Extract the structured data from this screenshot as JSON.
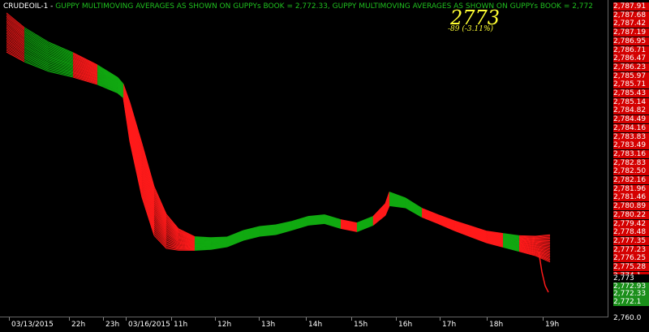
{
  "header": {
    "symbol": "CRUDEOIL-1",
    "separator": " - ",
    "indicator_1": "GUPPY MULTIMOVING AVERAGES AS SHOWN ON GUPPYs BOOK = 2,772.33,",
    "indicator_2": "GUPPY MULTIMOVING AVERAGES AS SHOWN ON GUPPYs BOOK = 2,772",
    "big_price": "2773",
    "change": "-89  (-3.11%)"
  },
  "price_axis": {
    "labels": [
      "2,787.91",
      "2,787.68",
      "2,787.42",
      "2,787.19",
      "2,786.95",
      "2,786.71",
      "2,786.47",
      "2,786.23",
      "2,785.97",
      "2,785.71",
      "2,785.43",
      "2,785.14",
      "2,784.82",
      "2,784.49",
      "2,784.16",
      "2,783.83",
      "2,783.49",
      "2,783.16",
      "2,782.83",
      "2,782.50",
      "2,782.16",
      "2,781.96",
      "2,781.46",
      "2,780.89",
      "2,780.22",
      "2,779.42",
      "2,778.48",
      "2,777.35",
      "2,777.23",
      "2,776.25",
      "2,775.28",
      "2,774.1"
    ],
    "current_labels": [
      "2,773",
      "2,772.93",
      "2,772.33",
      "2,772.1"
    ],
    "bottom_label": "2,760.0"
  },
  "time_axis": {
    "labels": [
      "03/13/2015",
      "22h",
      "23h",
      "03/16/2015",
      "11h",
      "12h",
      "13h",
      "14h",
      "15h",
      "16h",
      "17h",
      "18h",
      "19h"
    ]
  },
  "colors": {
    "background": "#000000",
    "bull": "#11aa11",
    "bear": "#ff1a1a",
    "text_green": "#1fbf1f",
    "big_price": "#ffff33",
    "price_box_red": "#d40000",
    "price_box_green": "#1a8f1a"
  }
}
